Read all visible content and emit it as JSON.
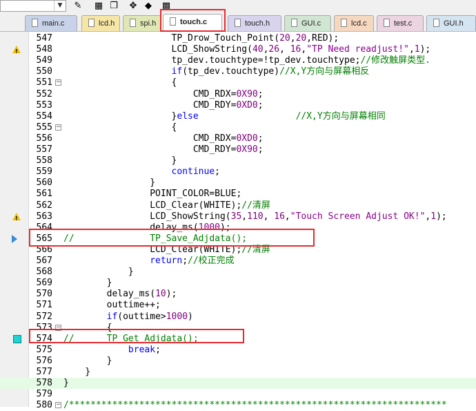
{
  "toolbar": {
    "target_dropdown_value": "",
    "buttons": [
      {
        "name": "build-icon",
        "glyph": "✎"
      },
      {
        "name": "load-icon",
        "glyph": "▦"
      },
      {
        "name": "copy-icon",
        "glyph": "❐"
      },
      {
        "name": "debug-icon",
        "glyph": "✥"
      },
      {
        "name": "settings-icon",
        "glyph": "◆"
      },
      {
        "name": "pack-icon",
        "glyph": "▩"
      }
    ]
  },
  "tabs": [
    {
      "label": "main.c",
      "color": "#c8d2e8",
      "active": false
    },
    {
      "label": "lcd.h",
      "color": "#f6e6a6",
      "active": false
    },
    {
      "label": "spi.h",
      "color": "#dfe8b4",
      "active": false
    },
    {
      "label": "touch.c",
      "color": "#ffffff",
      "active": true
    },
    {
      "label": "touch.h",
      "color": "#d8d4ee",
      "active": false
    },
    {
      "label": "GUI.c",
      "color": "#d0e6d2",
      "active": false
    },
    {
      "label": "lcd.c",
      "color": "#f6d8c0",
      "active": false
    },
    {
      "label": "test.c",
      "color": "#ecd4e0",
      "active": false
    },
    {
      "label": "GUI.h",
      "color": "#d4e4f0",
      "active": false
    }
  ],
  "code_lines": [
    {
      "n": "547",
      "marker": "",
      "fold": "",
      "html_key": "l547"
    },
    {
      "n": "548",
      "marker": "warning",
      "fold": "",
      "html_key": "l548"
    },
    {
      "n": "549",
      "marker": "",
      "fold": "",
      "html_key": "l549"
    },
    {
      "n": "550",
      "marker": "",
      "fold": "",
      "html_key": "l550"
    },
    {
      "n": "551",
      "marker": "",
      "fold": "minus",
      "html_key": "l551"
    },
    {
      "n": "552",
      "marker": "",
      "fold": "",
      "html_key": "l552"
    },
    {
      "n": "553",
      "marker": "",
      "fold": "",
      "html_key": "l553"
    },
    {
      "n": "554",
      "marker": "",
      "fold": "",
      "html_key": "l554"
    },
    {
      "n": "555",
      "marker": "",
      "fold": "minus",
      "html_key": "l555"
    },
    {
      "n": "556",
      "marker": "",
      "fold": "",
      "html_key": "l556"
    },
    {
      "n": "557",
      "marker": "",
      "fold": "",
      "html_key": "l557"
    },
    {
      "n": "558",
      "marker": "",
      "fold": "",
      "html_key": "l558"
    },
    {
      "n": "559",
      "marker": "",
      "fold": "",
      "html_key": "l559"
    },
    {
      "n": "560",
      "marker": "",
      "fold": "",
      "html_key": "l560"
    },
    {
      "n": "561",
      "marker": "",
      "fold": "",
      "html_key": "l561"
    },
    {
      "n": "562",
      "marker": "",
      "fold": "",
      "html_key": "l562"
    },
    {
      "n": "563",
      "marker": "warning",
      "fold": "",
      "html_key": "l563"
    },
    {
      "n": "564",
      "marker": "",
      "fold": "",
      "html_key": "l564"
    },
    {
      "n": "565",
      "marker": "arrow",
      "fold": "",
      "html_key": "l565"
    },
    {
      "n": "566",
      "marker": "",
      "fold": "",
      "html_key": "l566"
    },
    {
      "n": "567",
      "marker": "",
      "fold": "",
      "html_key": "l567"
    },
    {
      "n": "568",
      "marker": "",
      "fold": "",
      "html_key": "l568"
    },
    {
      "n": "569",
      "marker": "",
      "fold": "",
      "html_key": "l569"
    },
    {
      "n": "570",
      "marker": "",
      "fold": "",
      "html_key": "l570"
    },
    {
      "n": "571",
      "marker": "",
      "fold": "",
      "html_key": "l571"
    },
    {
      "n": "572",
      "marker": "",
      "fold": "",
      "html_key": "l572"
    },
    {
      "n": "573",
      "marker": "",
      "fold": "minus",
      "html_key": "l573"
    },
    {
      "n": "574",
      "marker": "breakpoint",
      "fold": "",
      "html_key": "l574"
    },
    {
      "n": "575",
      "marker": "",
      "fold": "",
      "html_key": "l575"
    },
    {
      "n": "576",
      "marker": "",
      "fold": "",
      "html_key": "l576"
    },
    {
      "n": "577",
      "marker": "",
      "fold": "",
      "html_key": "l577"
    },
    {
      "n": "578",
      "marker": "",
      "fold": "",
      "html_key": "l578",
      "current": true
    },
    {
      "n": "579",
      "marker": "",
      "fold": "",
      "html_key": "l579"
    },
    {
      "n": "580",
      "marker": "",
      "fold": "minus",
      "html_key": "l580"
    }
  ],
  "code_text": {
    "l547": [
      [
        "",
        "                    TP_Drow_Touch_Point("
      ],
      [
        "num",
        "20"
      ],
      [
        "",
        ","
      ],
      [
        "num",
        "20"
      ],
      [
        "",
        ",RED);"
      ]
    ],
    "l548": [
      [
        "",
        "                    LCD_ShowString("
      ],
      [
        "num",
        "40"
      ],
      [
        "",
        ","
      ],
      [
        "num",
        "26"
      ],
      [
        "",
        ", "
      ],
      [
        "num",
        "16"
      ],
      [
        "",
        ","
      ],
      [
        "str",
        "\"TP Need readjust!\""
      ],
      [
        "",
        ","
      ],
      [
        "num",
        "1"
      ],
      [
        "",
        ");"
      ]
    ],
    "l549": [
      [
        "",
        "                    tp_dev.touchtype=!tp_dev.touchtype;"
      ],
      [
        "cm",
        "//修改触屏类型."
      ]
    ],
    "l550": [
      [
        "",
        "                    "
      ],
      [
        "kw",
        "if"
      ],
      [
        "",
        "(tp_dev.touchtype)"
      ],
      [
        "cm",
        "//X,Y方向与屏幕相反"
      ]
    ],
    "l551": [
      [
        "",
        "                    {"
      ]
    ],
    "l552": [
      [
        "",
        "                        CMD_RDX="
      ],
      [
        "num",
        "0X90"
      ],
      [
        "",
        ";"
      ]
    ],
    "l553": [
      [
        "",
        "                        CMD_RDY="
      ],
      [
        "num",
        "0XD0"
      ],
      [
        "",
        ";"
      ]
    ],
    "l554": [
      [
        "",
        "                    }"
      ],
      [
        "kw",
        "else"
      ],
      [
        "",
        "                  "
      ],
      [
        "cm",
        "//X,Y方向与屏幕相同"
      ]
    ],
    "l555": [
      [
        "",
        "                    {"
      ]
    ],
    "l556": [
      [
        "",
        "                        CMD_RDX="
      ],
      [
        "num",
        "0XD0"
      ],
      [
        "",
        ";"
      ]
    ],
    "l557": [
      [
        "",
        "                        CMD_RDY="
      ],
      [
        "num",
        "0X90"
      ],
      [
        "",
        ";"
      ]
    ],
    "l558": [
      [
        "",
        "                    }"
      ]
    ],
    "l559": [
      [
        "",
        "                    "
      ],
      [
        "kw",
        "continue"
      ],
      [
        "",
        ";"
      ]
    ],
    "l560": [
      [
        "",
        "                }"
      ]
    ],
    "l561": [
      [
        "",
        "                POINT_COLOR=BLUE;"
      ]
    ],
    "l562": [
      [
        "",
        "                LCD_Clear(WHITE);"
      ],
      [
        "cm",
        "//清屏"
      ]
    ],
    "l563": [
      [
        "",
        "                LCD_ShowString("
      ],
      [
        "num",
        "35"
      ],
      [
        "",
        ","
      ],
      [
        "num",
        "110"
      ],
      [
        "",
        ", "
      ],
      [
        "num",
        "16"
      ],
      [
        "",
        ","
      ],
      [
        "str",
        "\"Touch Screen Adjust OK!\""
      ],
      [
        "",
        ","
      ],
      [
        "num",
        "1"
      ],
      [
        "",
        ");"
      ]
    ],
    "l564": [
      [
        "",
        "                delay_ms("
      ],
      [
        "num",
        "1000"
      ],
      [
        "",
        ");"
      ]
    ],
    "l565": [
      [
        "cm",
        "//              TP_Save_Adjdata();"
      ]
    ],
    "l566": [
      [
        "",
        "                LCD_Clear(WHITE);"
      ],
      [
        "cm",
        "//清屏"
      ]
    ],
    "l567": [
      [
        "",
        "                "
      ],
      [
        "kw",
        "return"
      ],
      [
        "",
        ";"
      ],
      [
        "cm",
        "//校正完成"
      ]
    ],
    "l568": [
      [
        "",
        "            }"
      ]
    ],
    "l569": [
      [
        "",
        "        }"
      ]
    ],
    "l570": [
      [
        "",
        "        delay_ms("
      ],
      [
        "num",
        "10"
      ],
      [
        "",
        ");"
      ]
    ],
    "l571": [
      [
        "",
        "        outtime++;"
      ]
    ],
    "l572": [
      [
        "",
        "        "
      ],
      [
        "kw",
        "if"
      ],
      [
        "",
        "(outtime>"
      ],
      [
        "num",
        "1000"
      ],
      [
        "",
        ")"
      ]
    ],
    "l573": [
      [
        "",
        "        {"
      ]
    ],
    "l574": [
      [
        "cm",
        "//      TP_Get_Adjdata();"
      ]
    ],
    "l575": [
      [
        "",
        "            "
      ],
      [
        "kw",
        "break"
      ],
      [
        "",
        ";"
      ]
    ],
    "l576": [
      [
        "",
        "        }"
      ]
    ],
    "l577": [
      [
        "",
        "    }"
      ]
    ],
    "l578": [
      [
        "",
        "}"
      ]
    ],
    "l579": [
      [
        "",
        ""
      ]
    ],
    "l580": [
      [
        "cm",
        "/**********************************************************************"
      ]
    ]
  }
}
